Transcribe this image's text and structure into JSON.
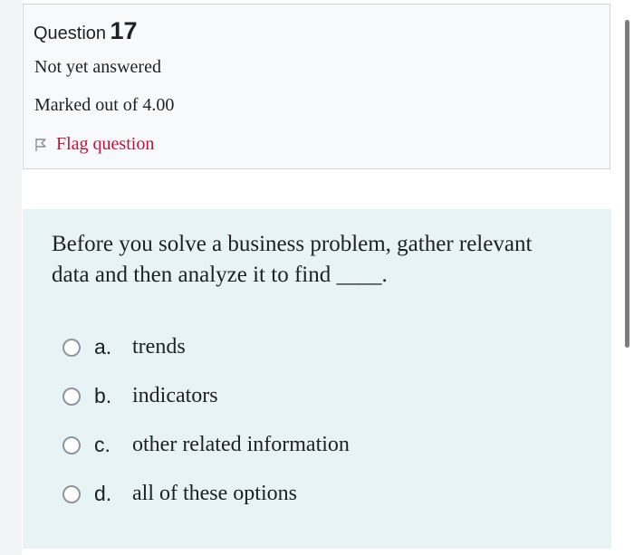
{
  "question": {
    "label": "Question",
    "number": "17",
    "status": "Not yet answered",
    "marks": "Marked out of 4.00",
    "flag_label": "Flag question"
  },
  "prompt": "Before you solve a business problem, gather relevant data and then analyze it to find ____.",
  "answers": [
    {
      "letter": "a.",
      "text": "trends"
    },
    {
      "letter": "b.",
      "text": "indicators"
    },
    {
      "letter": "c.",
      "text": "other related information"
    },
    {
      "letter": "d.",
      "text": "all of these options"
    }
  ],
  "colors": {
    "flag": "#c0143c",
    "panel": "#e7f3f5",
    "info_box": "#f8f9fa"
  },
  "icons": {
    "flag": "flag-icon",
    "radio": "radio-icon"
  }
}
